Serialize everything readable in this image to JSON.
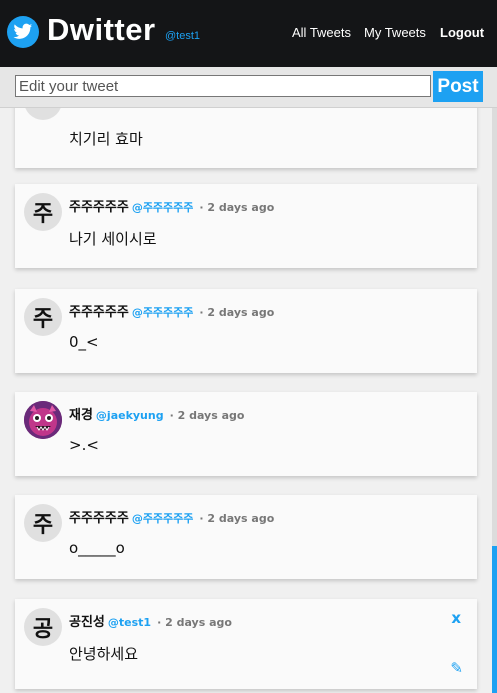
{
  "header": {
    "logo_icon": "twitter-bird-icon",
    "title": "Dwitter",
    "current_user_handle": "@test1",
    "nav": [
      "All Tweets",
      "My Tweets",
      "Logout"
    ]
  },
  "composer": {
    "placeholder": "Edit your tweet",
    "post_label": "Post"
  },
  "tweets": [
    {
      "avatar": "",
      "name": "",
      "handle": "",
      "ago": "",
      "text": "치기리 효마"
    },
    {
      "avatar": "주",
      "name": "주주주주주",
      "handle": "@주주주주주",
      "ago": "· 2 days ago",
      "text": "나기 세이시로"
    },
    {
      "avatar": "주",
      "name": "주주주주주",
      "handle": "@주주주주주",
      "ago": "· 2 days ago",
      "text": "0_<"
    },
    {
      "avatar": "",
      "name": "재경",
      "handle": "@jaekyung",
      "ago": "· 2 days ago",
      "text": ">.<"
    },
    {
      "avatar": "주",
      "name": "주주주주주",
      "handle": "@주주주주주",
      "ago": "· 2 days ago",
      "text": "o_____o"
    },
    {
      "avatar": "공",
      "name": "공진성",
      "handle": "@test1",
      "ago": "· 2 days ago",
      "text": "안녕하세요",
      "delete_label": "x",
      "edit_icon": "pencil-icon"
    }
  ],
  "colors": {
    "accent": "#1da1f2",
    "header_bg": "#141517"
  }
}
